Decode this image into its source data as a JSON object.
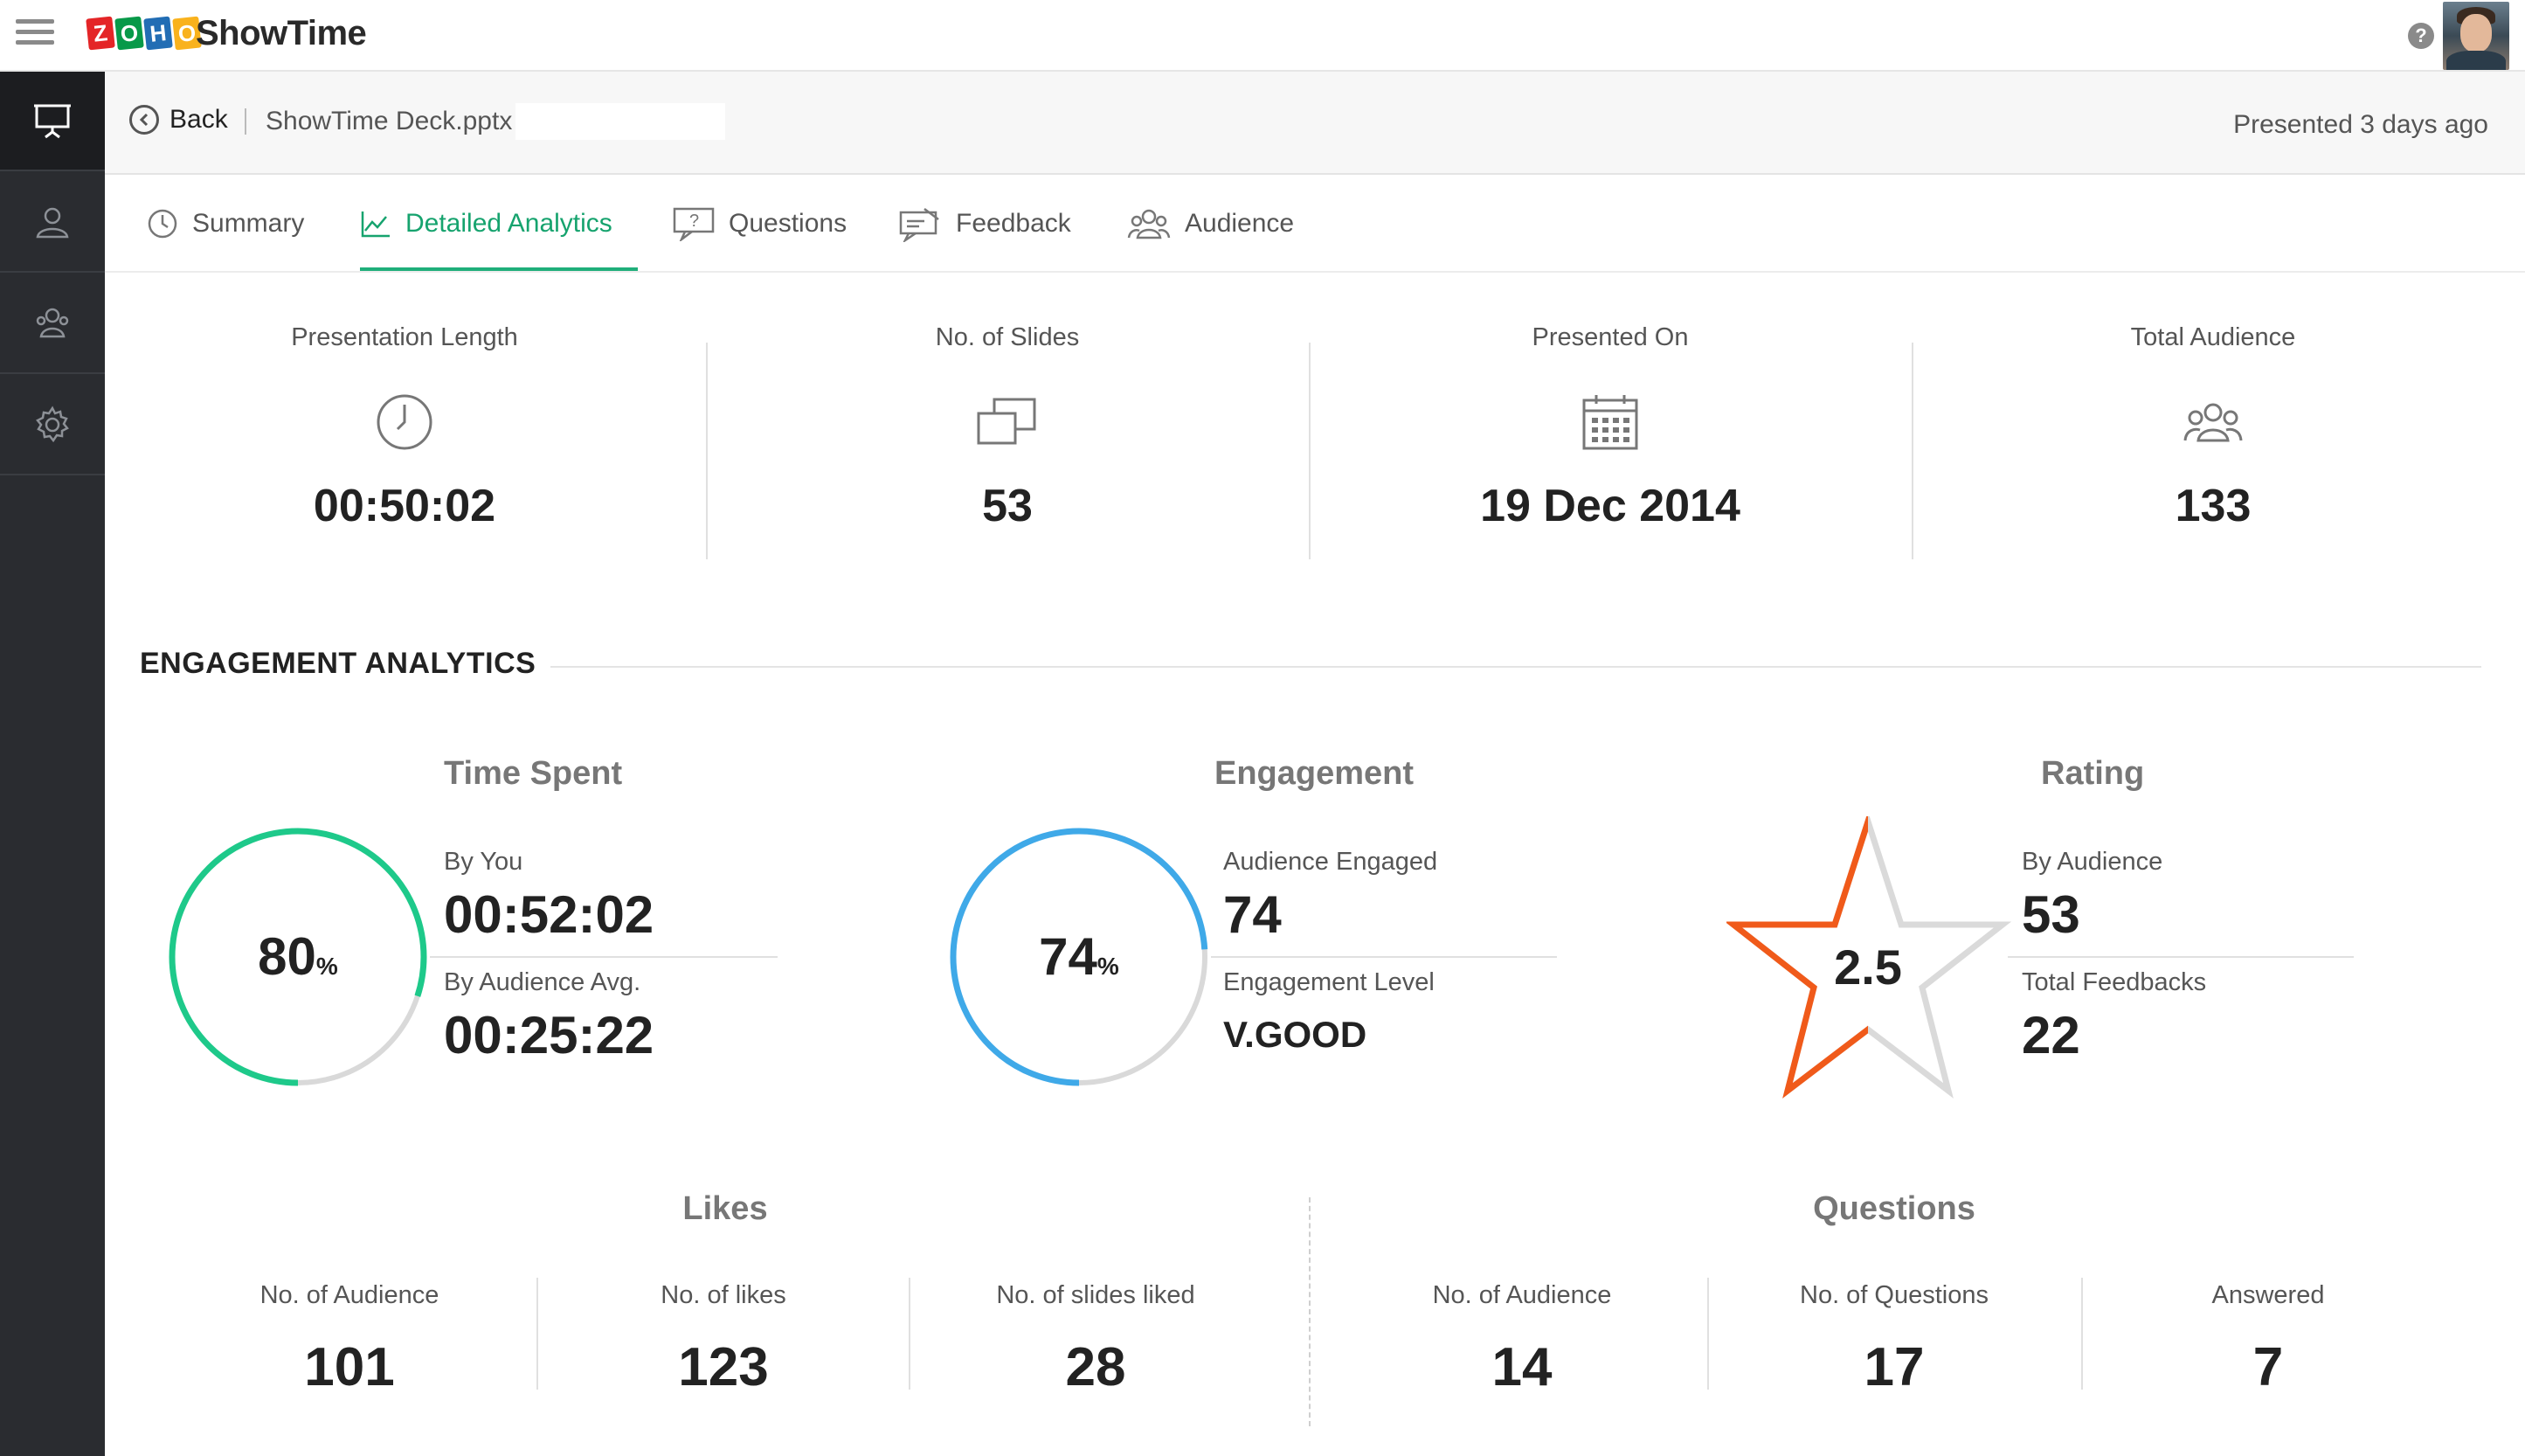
{
  "app": {
    "logo_letters": [
      "Z",
      "O",
      "H",
      "O"
    ],
    "logo_colors": [
      "#e42527",
      "#089949",
      "#226db4",
      "#f9b21d"
    ],
    "name": "ShowTime",
    "help_label": "?"
  },
  "header": {
    "back_label": "Back",
    "file_name": "ShowTime Deck.pptx",
    "presented_ago": "Presented 3 days ago"
  },
  "tabs": [
    {
      "label": "Summary",
      "icon": "clock-icon",
      "active": false
    },
    {
      "label": "Detailed Analytics",
      "icon": "line-chart-icon",
      "active": true
    },
    {
      "label": "Questions",
      "icon": "question-bubble-icon",
      "active": false
    },
    {
      "label": "Feedback",
      "icon": "feedback-icon",
      "active": false
    },
    {
      "label": "Audience",
      "icon": "audience-icon",
      "active": false
    }
  ],
  "stats": [
    {
      "label": "Presentation Length",
      "value": "00:50:02",
      "icon": "clock-icon"
    },
    {
      "label": "No. of Slides",
      "value": "53",
      "icon": "slides-icon"
    },
    {
      "label": "Presented On",
      "value": "19 Dec 2014",
      "icon": "calendar-icon"
    },
    {
      "label": "Total Audience",
      "value": "133",
      "icon": "audience-icon"
    }
  ],
  "engagement": {
    "section_title": "ENGAGEMENT ANALYTICS",
    "time_spent": {
      "title": "Time Spent",
      "percent": "80",
      "percent_value": 80,
      "unit": "%",
      "by_you_label": "By You",
      "by_you_value": "00:52:02",
      "avg_label": "By Audience Avg.",
      "avg_value": "00:25:22",
      "color": "#1ec98a"
    },
    "engagement": {
      "title": "Engagement",
      "percent": "74",
      "percent_value": 74,
      "unit": "%",
      "engaged_label": "Audience Engaged",
      "engaged_value": "74",
      "level_label": "Engagement Level",
      "level_value": "V.GOOD",
      "color": "#3fa9e8"
    },
    "rating": {
      "title": "Rating",
      "value": "2.5",
      "fraction": 0.5,
      "by_audience_label": "By Audience",
      "by_audience_value": "53",
      "feedbacks_label": "Total Feedbacks",
      "feedbacks_value": "22",
      "color": "#f05a1a"
    }
  },
  "likes": {
    "title": "Likes",
    "cells": [
      {
        "label": "No. of Audience",
        "value": "101"
      },
      {
        "label": "No. of likes",
        "value": "123"
      },
      {
        "label": "No. of slides liked",
        "value": "28"
      }
    ]
  },
  "questions": {
    "title": "Questions",
    "cells": [
      {
        "label": "No. of Audience",
        "value": "14"
      },
      {
        "label": "No. of Questions",
        "value": "17"
      },
      {
        "label": "Answered",
        "value": "7"
      }
    ]
  },
  "colors": {
    "accent": "#16a36e",
    "sidebar": "#2a2c30",
    "ring_track": "#d9d9d9"
  }
}
